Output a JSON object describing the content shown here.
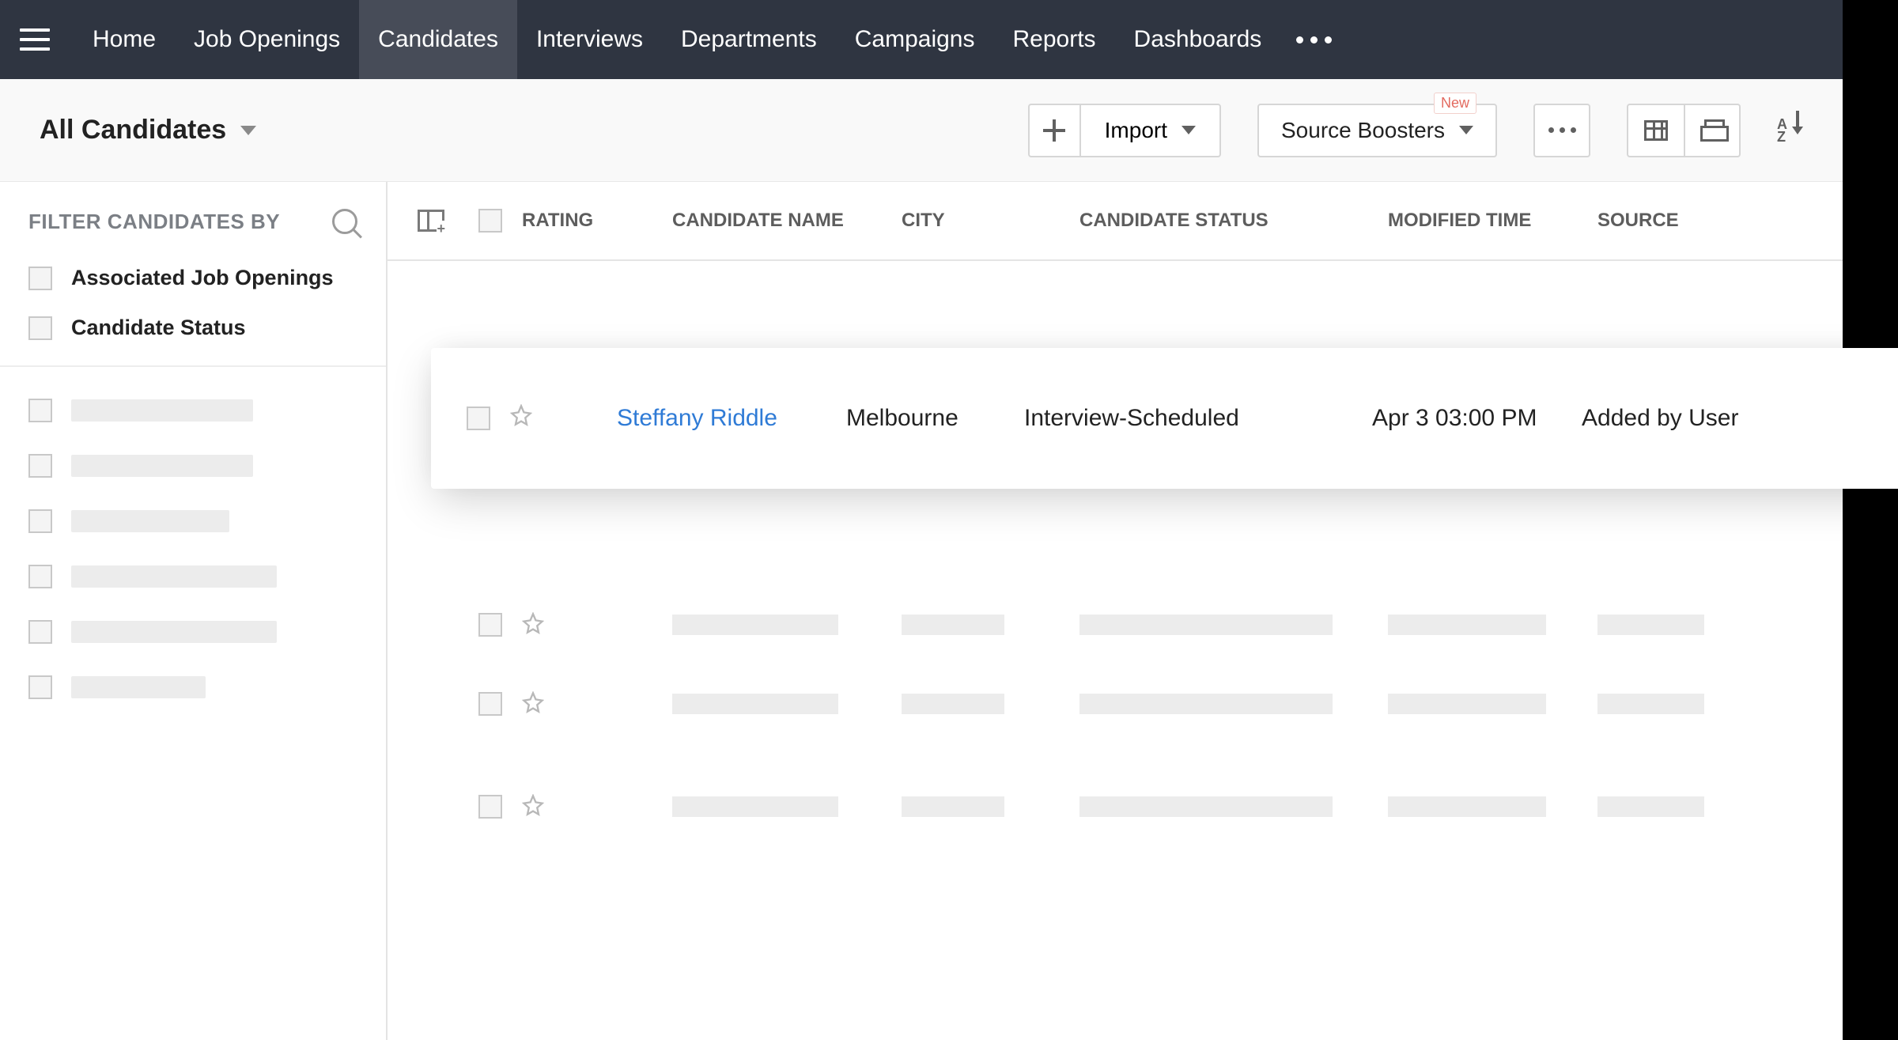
{
  "nav": {
    "items": [
      "Home",
      "Job Openings",
      "Candidates",
      "Interviews",
      "Departments",
      "Campaigns",
      "Reports",
      "Dashboards"
    ],
    "active_index": 2
  },
  "subheader": {
    "view_title": "All Candidates",
    "import_label": "Import",
    "boosters_label": "Source Boosters",
    "new_badge": "New"
  },
  "sidebar": {
    "filter_header": "FILTER CANDIDATES BY",
    "filters": [
      {
        "label": "Associated Job Openings"
      },
      {
        "label": "Candidate Status"
      }
    ]
  },
  "table": {
    "columns": [
      "RATING",
      "CANDIDATE NAME",
      "CITY",
      "CANDIDATE STATUS",
      "MODIFIED TIME",
      "SOURCE"
    ],
    "highlight_row": {
      "name": "Steffany Riddle",
      "city": "Melbourne",
      "status": "Interview-Scheduled",
      "modified": "Apr 3 03:00 PM",
      "source": "Added by User"
    }
  }
}
